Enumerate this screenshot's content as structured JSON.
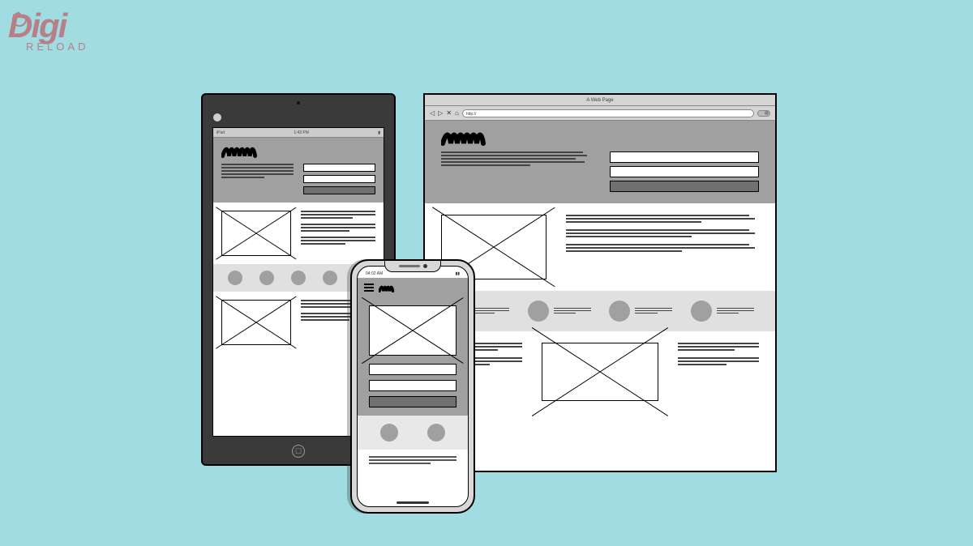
{
  "logo": {
    "brand": "Digi",
    "subtitle": "RELOAD"
  },
  "browser": {
    "title": "A Web Page",
    "url_placeholder": "http://"
  },
  "tablet": {
    "carrier": "iPad",
    "time": "1:43 PM"
  },
  "phone": {
    "time": "04:02 AM"
  }
}
